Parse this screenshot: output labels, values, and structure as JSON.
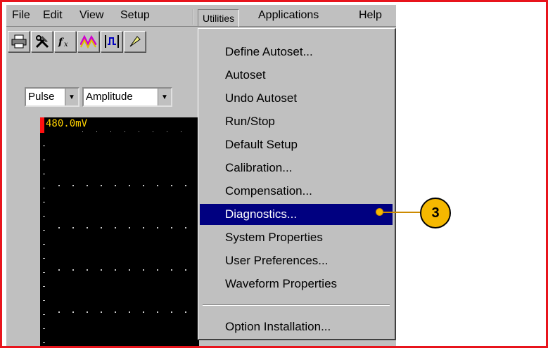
{
  "menubar": {
    "items": [
      "File",
      "Edit",
      "View",
      "Setup",
      "Utilities",
      "Applications",
      "Help"
    ],
    "active": "Utilities"
  },
  "toolbar": {
    "buttons": [
      "printer-icon",
      "tools-icon",
      "math-fx-icon",
      "waveform-color-icon",
      "measurement-icon",
      "cursor-icon"
    ],
    "pulse_combo": "Pulse",
    "amplitude_combo": "Amplitude"
  },
  "scope": {
    "scale_label": "480.0mV",
    "background_color": "#000000",
    "label_color": "#ffd200"
  },
  "utilities_menu": {
    "items": [
      "Define Autoset...",
      "Autoset",
      "Undo Autoset",
      "Run/Stop",
      "Default Setup",
      "Calibration...",
      "Compensation...",
      "Diagnostics...",
      "System Properties",
      "User Preferences...",
      "Waveform Properties",
      "Option Installation..."
    ],
    "selected": "Diagnostics...",
    "highlight_color": "#000080"
  },
  "callout": {
    "number": "3",
    "color": "#f5b800"
  },
  "frame_color": "#e8141c"
}
